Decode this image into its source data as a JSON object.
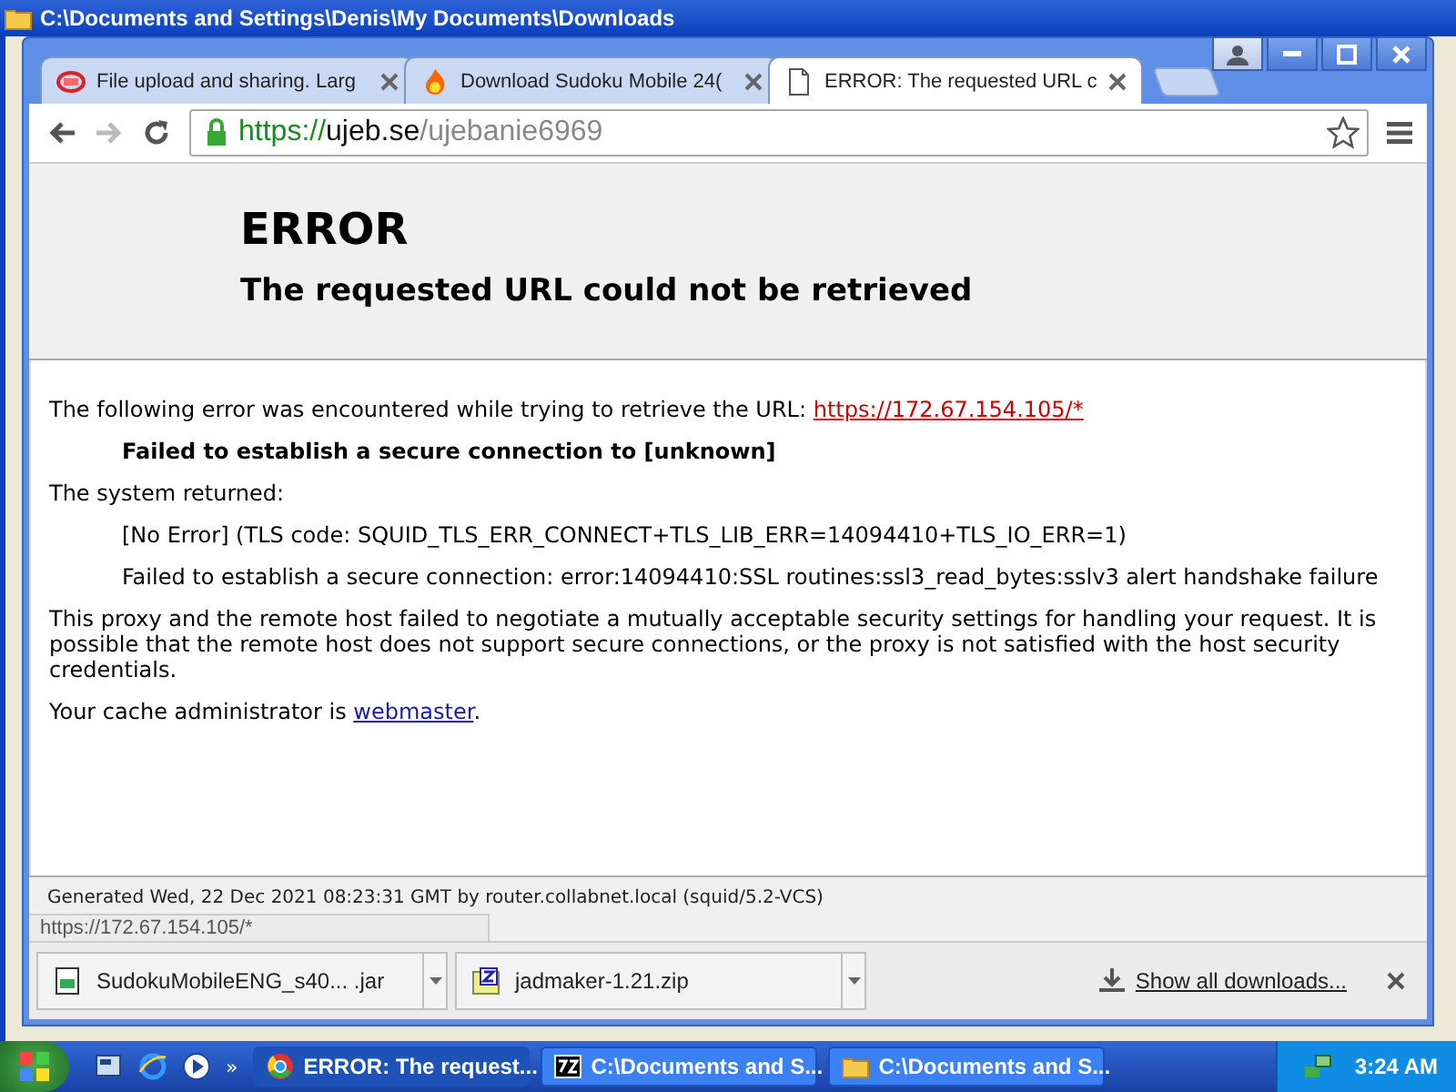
{
  "background_window": {
    "title": "C:\\Documents and Settings\\Denis\\My Documents\\Downloads"
  },
  "tabs": [
    {
      "title": "File upload and sharing. Larg",
      "selected": false
    },
    {
      "title": "Download Sudoku Mobile 24(",
      "selected": false
    },
    {
      "title": "ERROR: The requested URL c",
      "selected": true
    }
  ],
  "address_bar": {
    "scheme": "https://",
    "host": "ujeb.se",
    "path": "/ujebanie6969",
    "secure": true
  },
  "page": {
    "heading": "ERROR",
    "subheading": "The requested URL could not be retrieved",
    "intro": "The following error was encountered while trying to retrieve the URL: ",
    "intro_link": "https://172.67.154.105/*",
    "error_title": "Failed to establish a secure connection to [unknown]",
    "system_returned": "The system returned:",
    "details": [
      "[No Error] (TLS code: SQUID_TLS_ERR_CONNECT+TLS_LIB_ERR=14094410+TLS_IO_ERR=1)",
      "Failed to establish a secure connection: error:14094410:SSL routines:ssl3_read_bytes:sslv3 alert handshake failure"
    ],
    "explanation": "This proxy and the remote host failed to negotiate a mutually acceptable security settings for handling your request. It is possible that the remote host does not support secure connections, or the proxy is not satisfied with the host security credentials.",
    "admin_text": "Your cache administrator is ",
    "admin_link": "webmaster",
    "admin_end": ".",
    "footer": "Generated Wed, 22 Dec 2021 08:23:31 GMT by router.collabnet.local (squid/5.2-VCS)"
  },
  "status_bubble": "https://172.67.154.105/*",
  "downloads": {
    "items": [
      {
        "name": "SudokuMobileENG_s40... .jar"
      },
      {
        "name": "jadmaker-1.21.zip"
      }
    ],
    "show_all": "Show all downloads..."
  },
  "taskbar": {
    "more": "»",
    "buttons": [
      {
        "label": "ERROR: The request...",
        "selected": true
      },
      {
        "label": "C:\\Documents and S...",
        "selected": false
      },
      {
        "label": "C:\\Documents and S...",
        "selected": false
      }
    ],
    "clock": "3:24 AM"
  }
}
